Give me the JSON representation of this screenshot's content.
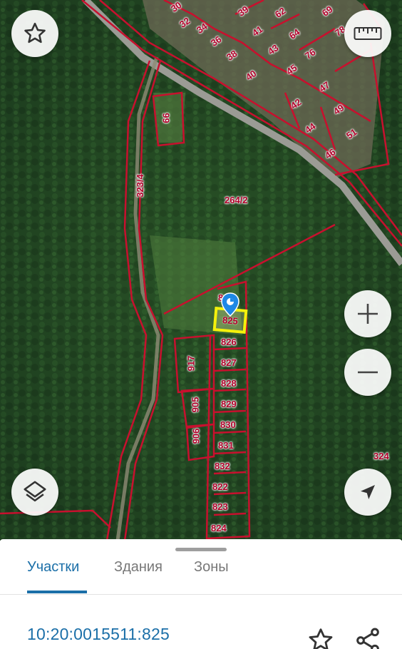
{
  "map": {
    "plot_labels": {
      "top_cluster": [
        "30",
        "32",
        "34",
        "36",
        "38",
        "39",
        "40",
        "41",
        "42",
        "43",
        "44",
        "45",
        "46",
        "47",
        "49",
        "51",
        "62",
        "64",
        "69",
        "76",
        "78"
      ],
      "area_a": "66",
      "area_b": "264/2",
      "road": "323/4",
      "partial": "8",
      "column": [
        "826",
        "827",
        "828",
        "829",
        "830",
        "831",
        "832",
        "822",
        "823",
        "824"
      ],
      "left_column": [
        "917",
        "905",
        "906"
      ],
      "right_edge": "324"
    },
    "selected_plot": "825",
    "colors": {
      "boundary": "#c8102e",
      "highlight": "#f4f10b",
      "marker": "#1e88e5",
      "accent": "#1b6fa8"
    },
    "icons": {
      "favorite": "star-outline-icon",
      "ruler": "ruler-icon",
      "zoom_in": "plus-icon",
      "zoom_out": "minus-icon",
      "layers": "layers-icon",
      "locate": "navigation-arrow-icon",
      "share": "share-icon"
    }
  },
  "sheet": {
    "tabs": [
      {
        "label": "Участки",
        "active": true
      },
      {
        "label": "Здания",
        "active": false
      },
      {
        "label": "Зоны",
        "active": false
      }
    ],
    "cadastral_number": "10:20:0015511:825"
  }
}
